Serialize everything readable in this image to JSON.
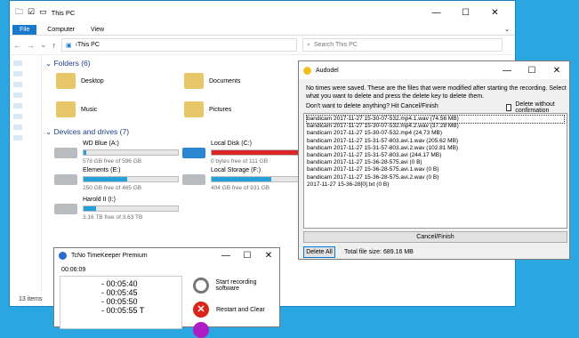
{
  "explorer": {
    "title": "This PC",
    "ribbon": {
      "file": "File",
      "computer": "Computer",
      "view": "View"
    },
    "address": "This PC",
    "search_placeholder": "Search This PC",
    "folders_header": "Folders (6)",
    "folders": [
      {
        "name": "Desktop"
      },
      {
        "name": "Documents"
      },
      {
        "name": "Music"
      },
      {
        "name": "Pictures"
      }
    ],
    "drives_header": "Devices and drives (7)",
    "drives": [
      {
        "name": "WD Blue (A:)",
        "free": "578 GB free of 596 GB",
        "used_fraction": 0.03
      },
      {
        "name": "Local Disk (C:)",
        "free": "0 bytes free of 111 GB",
        "used_fraction": 1.0
      },
      {
        "name": "Elements (E:)",
        "free": "250 GB free of 465 GB",
        "used_fraction": 0.46
      },
      {
        "name": "Local Storage (F:)",
        "free": "404 GB free of 931 GB",
        "used_fraction": 0.57
      },
      {
        "name": "Harold II (I:)",
        "free": "3.16 TB free of 3.63 TB",
        "used_fraction": 0.13
      }
    ],
    "status": "13 items"
  },
  "audodel": {
    "title": "Audodel",
    "message": "No times were saved. These are the files that were modified after starting the recording. Select what you want to delete and press the delete key to delete them.",
    "question": "Don't want to delete anything? Hit Cancel/Finish",
    "checkbox_label": "Delete without confirmation",
    "files": [
      "bandicam 2017-11-27 15-30-07-532.mp4.1.wav (74.56 MB)",
      "bandicam 2017-11-27 15-30-07-532.mp4.2.wav (37.28 MB)",
      "bandicam 2017-11-27 15-30-07-532.mp4 (24.73 MB)",
      "bandicam 2017-11-27 15-31-57-803.avi.1.wav (205.62 MB)",
      "bandicam 2017-11-27 15-31-57-803.avi.2.wav (102.81 MB)",
      "bandicam 2017-11-27 15-31-57-803.avi (244.17 MB)",
      "bandicam 2017-11-27 15-36-28-575.avi (0 B)",
      "bandicam 2017-11-27 15-36-28-575.avi.1.wav (0 B)",
      "bandicam 2017-11-27 15-36-28-575.avi.2.wav (0 B)",
      "2017-11-27 15-36-28[0].txt (0 B)"
    ],
    "cancel_label": "Cancel/Finish",
    "delete_all_label": "Delete All",
    "total": "Total file size: 689.16 MB"
  },
  "timekeeper": {
    "title": "TcNo TimeKeeper Premium",
    "elapsed": "00:06:09",
    "times": [
      "- 00:05:40",
      "- 00:05:45",
      "- 00:05:50",
      "- 00:05:55 T"
    ],
    "start_label": "Start recording software",
    "restart_label": "Restart and Clear"
  }
}
